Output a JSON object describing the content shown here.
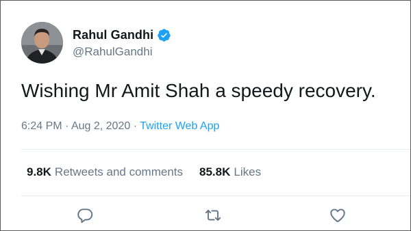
{
  "tweet": {
    "author": {
      "display_name": "Rahul Gandhi",
      "handle": "@RahulGandhi",
      "verified": true
    },
    "text": "Wishing Mr Amit Shah a speedy recovery.",
    "time": "6:24 PM",
    "date": "Aug 2, 2020",
    "separator": "·",
    "source": "Twitter Web App",
    "stats": {
      "retweets_count": "9.8K",
      "retweets_label": "Retweets and comments",
      "likes_count": "85.8K",
      "likes_label": "Likes"
    },
    "actions": {
      "reply_icon": "reply-icon",
      "retweet_icon": "retweet-icon",
      "like_icon": "heart-icon"
    }
  },
  "colors": {
    "text": "#14171a",
    "secondary": "#657786",
    "link": "#1da1f2",
    "verified": "#1da1f2",
    "divider": "#e6ecf0"
  }
}
